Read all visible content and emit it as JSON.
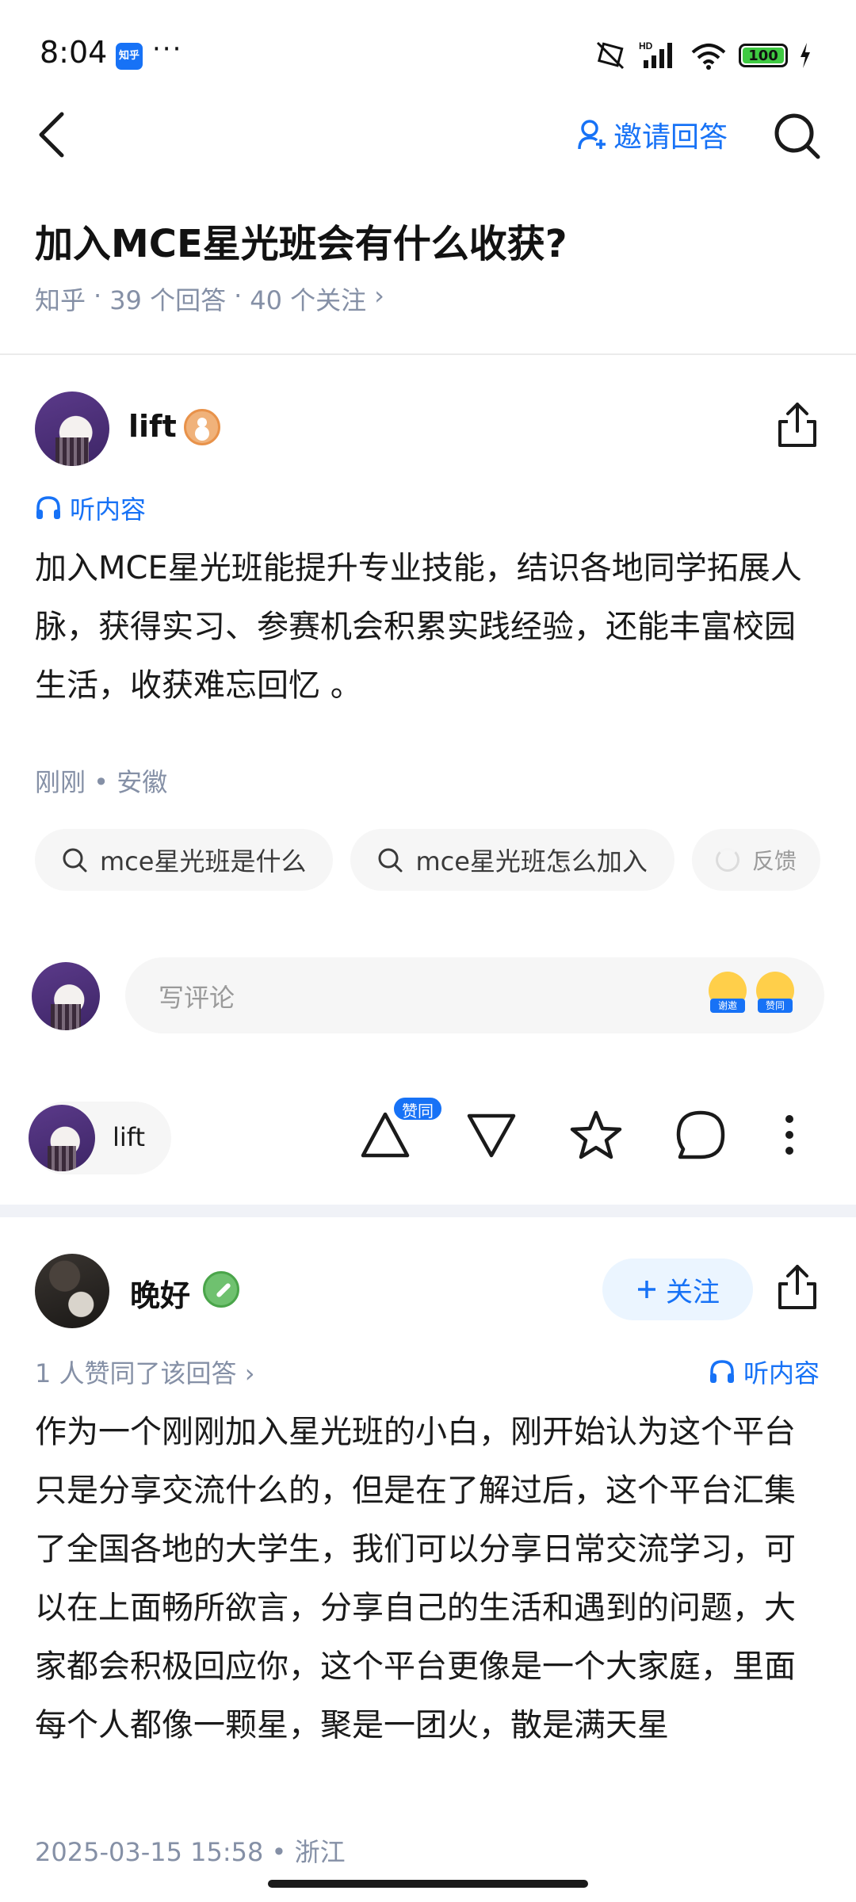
{
  "status_bar": {
    "time": "8:04",
    "app_badge": "知乎",
    "more": "···",
    "battery": "100"
  },
  "top_bar": {
    "invite_label": "邀请回答"
  },
  "question": {
    "title": "加入MCE星光班会有什么收获?",
    "source": "知乎",
    "answers": "39 个回答",
    "followers": "40 个关注",
    "sep": "·",
    "chevron": "›"
  },
  "answer1": {
    "author": "lift",
    "listen_label": "听内容",
    "text": "加入MCE星光班能提升专业技能，结识各地同学拓展人脉，获得实习、参赛机会积累实践经验，还能丰富校园生活，收获难忘回忆 。",
    "meta": "刚刚 • 安徽",
    "chips": [
      {
        "label": "mce星光班是什么"
      },
      {
        "label": "mce星光班怎么加入"
      }
    ],
    "feedback_label": "反馈",
    "comment_placeholder": "写评论",
    "emoji_labels": [
      "谢邀",
      "赞同"
    ],
    "pill_author": "lift",
    "vote_badge": "赞同"
  },
  "answer2": {
    "author": "晚好",
    "follow_label": "关注",
    "likes_text": "1 人赞同了该回答 ›",
    "listen_label": "听内容",
    "text": "作为一个刚刚加入星光班的小白，刚开始认为这个平台只是分享交流什么的，但是在了解过后，这个平台汇集了全国各地的大学生，我们可以分享日常交流学习，可以在上面畅所欲言，分享自己的生活和遇到的问题，大家都会积极回应你，这个平台更像是一个大家庭，里面每个人都像一颗星，聚是一团火，散是满天星",
    "meta": "2025-03-15 15:58 • 浙江"
  },
  "colors": {
    "accent": "#1772f6",
    "muted": "#8590a6",
    "chip_bg": "#f6f6f6"
  },
  "icons": [
    "back-arrow-icon",
    "person-add-icon",
    "search-icon",
    "share-icon",
    "headphones-icon",
    "upvote-icon",
    "downvote-icon",
    "star-icon",
    "comment-icon",
    "more-vertical-icon"
  ]
}
